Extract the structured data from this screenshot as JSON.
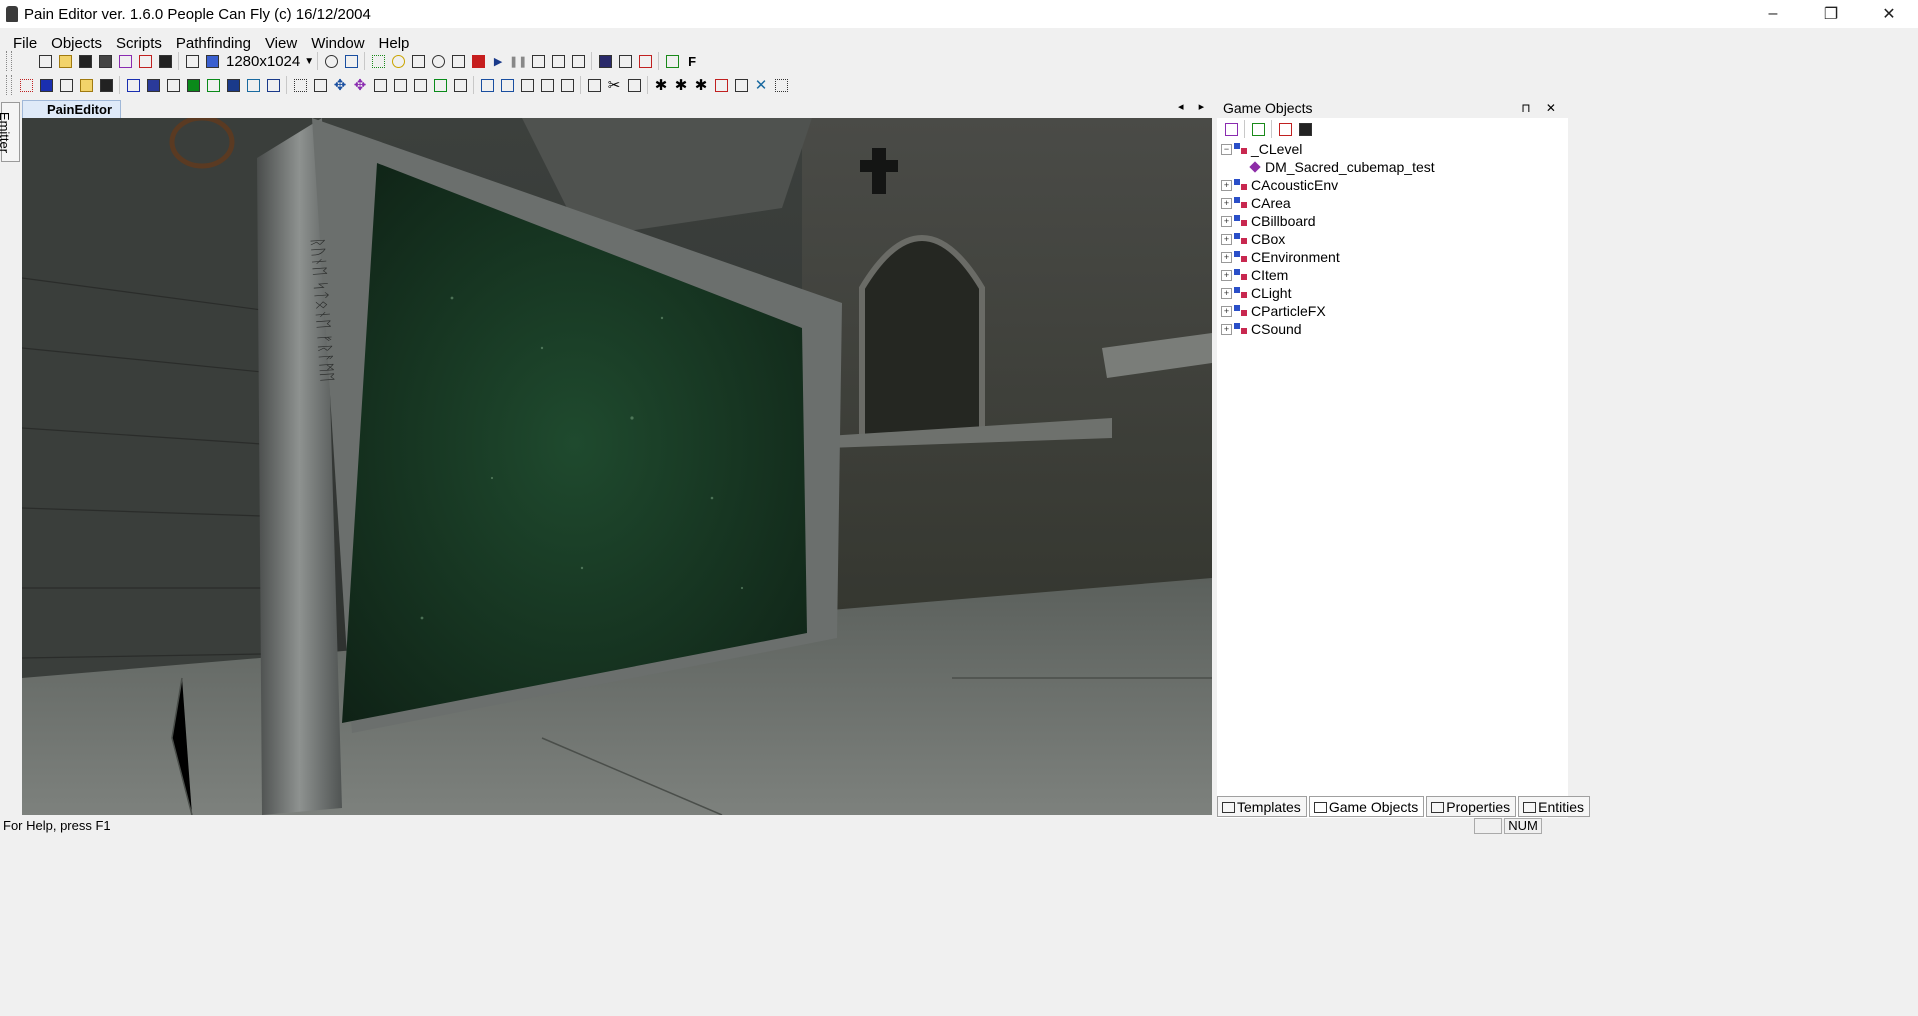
{
  "window": {
    "title": "Pain Editor  ver. 1.6.0  People Can Fly (c) 16/12/2004",
    "controls": {
      "minimize": "–",
      "restore": "❐",
      "close": "✕"
    }
  },
  "menu": [
    "File",
    "Objects",
    "Scripts",
    "Pathfinding",
    "View",
    "Window",
    "Help"
  ],
  "toolbar": {
    "resolution": "1280x1024",
    "f_label": "F"
  },
  "left_strip": {
    "emitter_tab": "Emitter"
  },
  "document": {
    "tab_label": "PainEditor",
    "controls": "◂ ▸ ✕"
  },
  "panel": {
    "title": "Game Objects",
    "pin_close": "⊓ ✕",
    "tree": {
      "root": "_CLevel",
      "root_child": "DM_Sacred_cubemap_test",
      "nodes": [
        "CAcousticEnv",
        "CArea",
        "CBillboard",
        "CBox",
        "CEnvironment",
        "CItem",
        "CLight",
        "CParticleFX",
        "CSound"
      ]
    },
    "bottom_tabs": [
      "Templates",
      "Game Objects",
      "Properties",
      "Entities"
    ]
  },
  "status": {
    "message": "For Help, press F1",
    "num": "NUM"
  }
}
